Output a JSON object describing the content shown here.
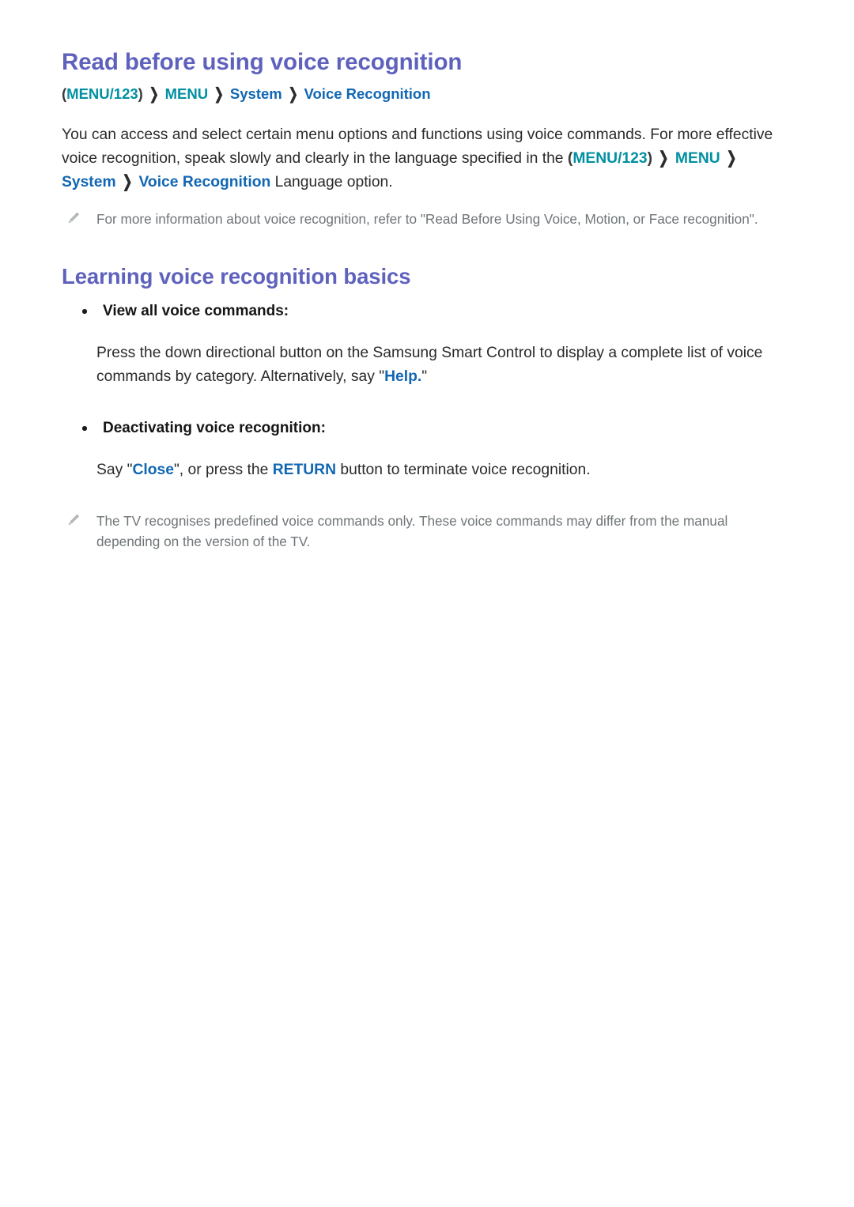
{
  "document": {
    "title": "Read before using voice recognition",
    "section_title": "Learning voice recognition basics"
  },
  "colors": {
    "heading": "#5f62bd",
    "teal_token": "#0090a2",
    "blue_token": "#1167b3",
    "body_text": "#2a2a2a",
    "note_text": "#6f7578",
    "background": "#ffffff"
  },
  "breadcrumb": {
    "open_paren": "(",
    "close_paren": ")",
    "chevron": "❯",
    "items": [
      {
        "label": "MENU/123",
        "style": "teal",
        "parenthesized": true
      },
      {
        "label": "MENU",
        "style": "teal",
        "parenthesized": false
      },
      {
        "label": "System",
        "style": "blue",
        "parenthesized": false
      },
      {
        "label": "Voice Recognition",
        "style": "blue",
        "parenthesized": false
      }
    ]
  },
  "intro_paragraph": {
    "text_before": "You can access and select certain menu options and functions using voice commands. For more effective voice recognition, speak slowly and clearly in the language specified in the ",
    "open_paren": "(",
    "token_menu123": "MENU/123",
    "close_paren": ")",
    "chevron": "❯",
    "token_menu": "MENU",
    "token_system": "System",
    "token_voice_recognition": "Voice Recognition",
    "text_after": " Language option."
  },
  "note_one": {
    "icon": "pencil-icon",
    "text": "For more information about voice recognition, refer to \"Read Before Using Voice, Motion, or Face recognition\"."
  },
  "bullets": [
    {
      "label": "View all voice commands:",
      "body_before": "Press the down directional button on the Samsung Smart Control to display a complete list of voice commands by category. Alternatively, say \"",
      "highlight": "Help.",
      "body_after": "\""
    },
    {
      "label": "Deactivating voice recognition:",
      "body_before": "Say \"",
      "highlight": "Close",
      "body_mid": "\", or press the ",
      "highlight_two": "RETURN",
      "body_after": " button to terminate voice recognition."
    }
  ],
  "note_two": {
    "icon": "pencil-icon",
    "text": "The TV recognises predefined voice commands only. These voice commands may differ from the manual depending on the version of the TV."
  }
}
